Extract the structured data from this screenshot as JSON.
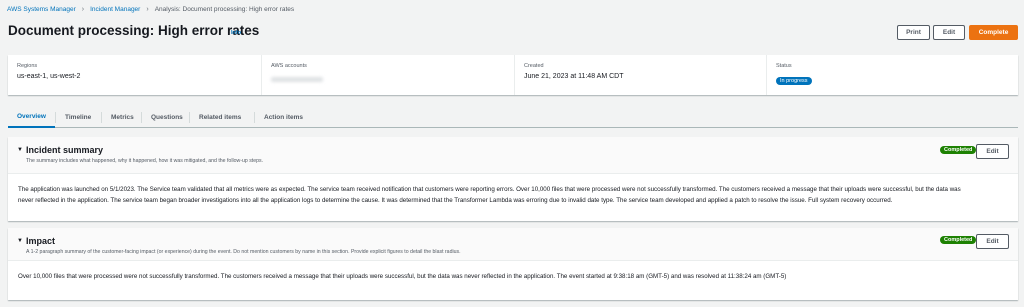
{
  "breadcrumb": {
    "items": [
      "AWS Systems Manager",
      "Incident Manager",
      "Analysis: Document processing: High error rates"
    ]
  },
  "page": {
    "title": "Document processing: High error rates",
    "info_label": "Info"
  },
  "actions": {
    "print_label": "Print",
    "edit_label": "Edit",
    "complete_label": "Complete"
  },
  "summary": {
    "regions_label": "Regions",
    "regions_value": "us-east-1, us-west-2",
    "accounts_label": "AWS accounts",
    "created_label": "Created",
    "created_value": "June 21, 2023 at 11:48 AM CDT",
    "status_label": "Status",
    "status_value": "In progress"
  },
  "tabs": [
    "Overview",
    "Timeline",
    "Metrics",
    "Questions",
    "Related items",
    "Action items"
  ],
  "sections": [
    {
      "title": "Incident summary",
      "description": "The summary includes what happened, why it happened, how it was mitigated, and the follow-up steps.",
      "badge": "Completed",
      "edit_label": "Edit",
      "body_lines": [
        "The application was launched on 5/1/2023. The Service team validated that all metrics were as expected. The service team received notification that customers were reporting errors. Over 10,000 files that were processed were not successfully transformed. The customers received a message that their uploads were successful, but the data was",
        "never reflected in the application. The service team began broader investigations into all the application logs to determine the cause. It was determined that the Transformer Lambda was erroring due to invalid date type. The service team developed and applied a patch to resolve the issue. Full system recovery occurred."
      ]
    },
    {
      "title": "Impact",
      "description": "A 1-2 paragraph summary of the customer-facing impact (or experience) during the event. Do not mention customers by name in this section. Provide explicit figures to detail the blast radius.",
      "badge": "Completed",
      "edit_label": "Edit",
      "body_lines": [
        "Over 10,000 files that were processed were not successfully transformed. The customers received a message that their uploads were successful, but the data was never reflected in the application. The event started at 9:38:18 am (GMT-5) and was resolved at 11:38:24 am (GMT-5)"
      ]
    }
  ],
  "colors": {
    "link": "#0073bb",
    "primary_button": "#ec7211",
    "completed_badge": "#1d8102",
    "status_in_progress": "#0073bb"
  }
}
